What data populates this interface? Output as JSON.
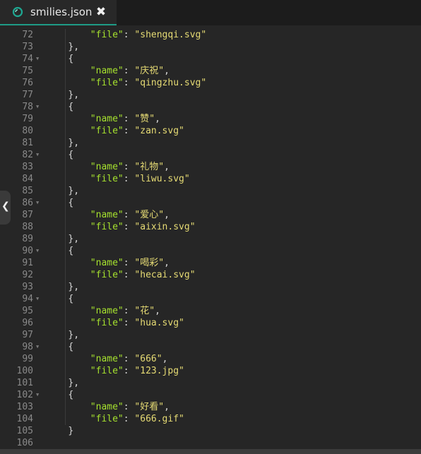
{
  "tab": {
    "title": "smilies.json",
    "close_glyph": "✖",
    "icon": "logo-icon"
  },
  "colors": {
    "key": "#a6e22e",
    "string": "#e6db74",
    "line_number": "#8a8a8a",
    "accent": "#1e9b86"
  },
  "code_lines": [
    {
      "n": "72",
      "fold": false,
      "indent": 2,
      "key": "\"file\"",
      "sep": ": ",
      "val": "\"shengqi.svg\"",
      "tail": ""
    },
    {
      "n": "73",
      "fold": false,
      "indent": 1,
      "punct": "},"
    },
    {
      "n": "74",
      "fold": true,
      "indent": 1,
      "punct": "{"
    },
    {
      "n": "75",
      "fold": false,
      "indent": 2,
      "key": "\"name\"",
      "sep": ": ",
      "val": "\"庆祝\"",
      "tail": ","
    },
    {
      "n": "76",
      "fold": false,
      "indent": 2,
      "key": "\"file\"",
      "sep": ": ",
      "val": "\"qingzhu.svg\"",
      "tail": ""
    },
    {
      "n": "77",
      "fold": false,
      "indent": 1,
      "punct": "},"
    },
    {
      "n": "78",
      "fold": true,
      "indent": 1,
      "punct": "{"
    },
    {
      "n": "79",
      "fold": false,
      "indent": 2,
      "key": "\"name\"",
      "sep": ": ",
      "val": "\"赞\"",
      "tail": ","
    },
    {
      "n": "80",
      "fold": false,
      "indent": 2,
      "key": "\"file\"",
      "sep": ": ",
      "val": "\"zan.svg\"",
      "tail": ""
    },
    {
      "n": "81",
      "fold": false,
      "indent": 1,
      "punct": "},"
    },
    {
      "n": "82",
      "fold": true,
      "indent": 1,
      "punct": "{"
    },
    {
      "n": "83",
      "fold": false,
      "indent": 2,
      "key": "\"name\"",
      "sep": ": ",
      "val": "\"礼物\"",
      "tail": ","
    },
    {
      "n": "84",
      "fold": false,
      "indent": 2,
      "key": "\"file\"",
      "sep": ": ",
      "val": "\"liwu.svg\"",
      "tail": ""
    },
    {
      "n": "85",
      "fold": false,
      "indent": 1,
      "punct": "},"
    },
    {
      "n": "86",
      "fold": true,
      "indent": 1,
      "punct": "{"
    },
    {
      "n": "87",
      "fold": false,
      "indent": 2,
      "key": "\"name\"",
      "sep": ": ",
      "val": "\"爱心\"",
      "tail": ","
    },
    {
      "n": "88",
      "fold": false,
      "indent": 2,
      "key": "\"file\"",
      "sep": ": ",
      "val": "\"aixin.svg\"",
      "tail": ""
    },
    {
      "n": "89",
      "fold": false,
      "indent": 1,
      "punct": "},"
    },
    {
      "n": "90",
      "fold": true,
      "indent": 1,
      "punct": "{"
    },
    {
      "n": "91",
      "fold": false,
      "indent": 2,
      "key": "\"name\"",
      "sep": ": ",
      "val": "\"喝彩\"",
      "tail": ","
    },
    {
      "n": "92",
      "fold": false,
      "indent": 2,
      "key": "\"file\"",
      "sep": ": ",
      "val": "\"hecai.svg\"",
      "tail": ""
    },
    {
      "n": "93",
      "fold": false,
      "indent": 1,
      "punct": "},"
    },
    {
      "n": "94",
      "fold": true,
      "indent": 1,
      "punct": "{"
    },
    {
      "n": "95",
      "fold": false,
      "indent": 2,
      "key": "\"name\"",
      "sep": ": ",
      "val": "\"花\"",
      "tail": ","
    },
    {
      "n": "96",
      "fold": false,
      "indent": 2,
      "key": "\"file\"",
      "sep": ": ",
      "val": "\"hua.svg\"",
      "tail": ""
    },
    {
      "n": "97",
      "fold": false,
      "indent": 1,
      "punct": "},"
    },
    {
      "n": "98",
      "fold": true,
      "indent": 1,
      "punct": "{"
    },
    {
      "n": "99",
      "fold": false,
      "indent": 2,
      "key": "\"name\"",
      "sep": ": ",
      "val": "\"666\"",
      "tail": ","
    },
    {
      "n": "100",
      "fold": false,
      "indent": 2,
      "key": "\"file\"",
      "sep": ": ",
      "val": "\"123.jpg\"",
      "tail": ""
    },
    {
      "n": "101",
      "fold": false,
      "indent": 1,
      "punct": "},"
    },
    {
      "n": "102",
      "fold": true,
      "indent": 1,
      "punct": "{"
    },
    {
      "n": "103",
      "fold": false,
      "indent": 2,
      "key": "\"name\"",
      "sep": ": ",
      "val": "\"好看\"",
      "tail": ","
    },
    {
      "n": "104",
      "fold": false,
      "indent": 2,
      "key": "\"file\"",
      "sep": ": ",
      "val": "\"666.gif\"",
      "tail": ""
    },
    {
      "n": "105",
      "fold": false,
      "indent": 1,
      "punct": "}"
    },
    {
      "n": "106",
      "fold": false,
      "indent": 0,
      "punct": ""
    }
  ]
}
